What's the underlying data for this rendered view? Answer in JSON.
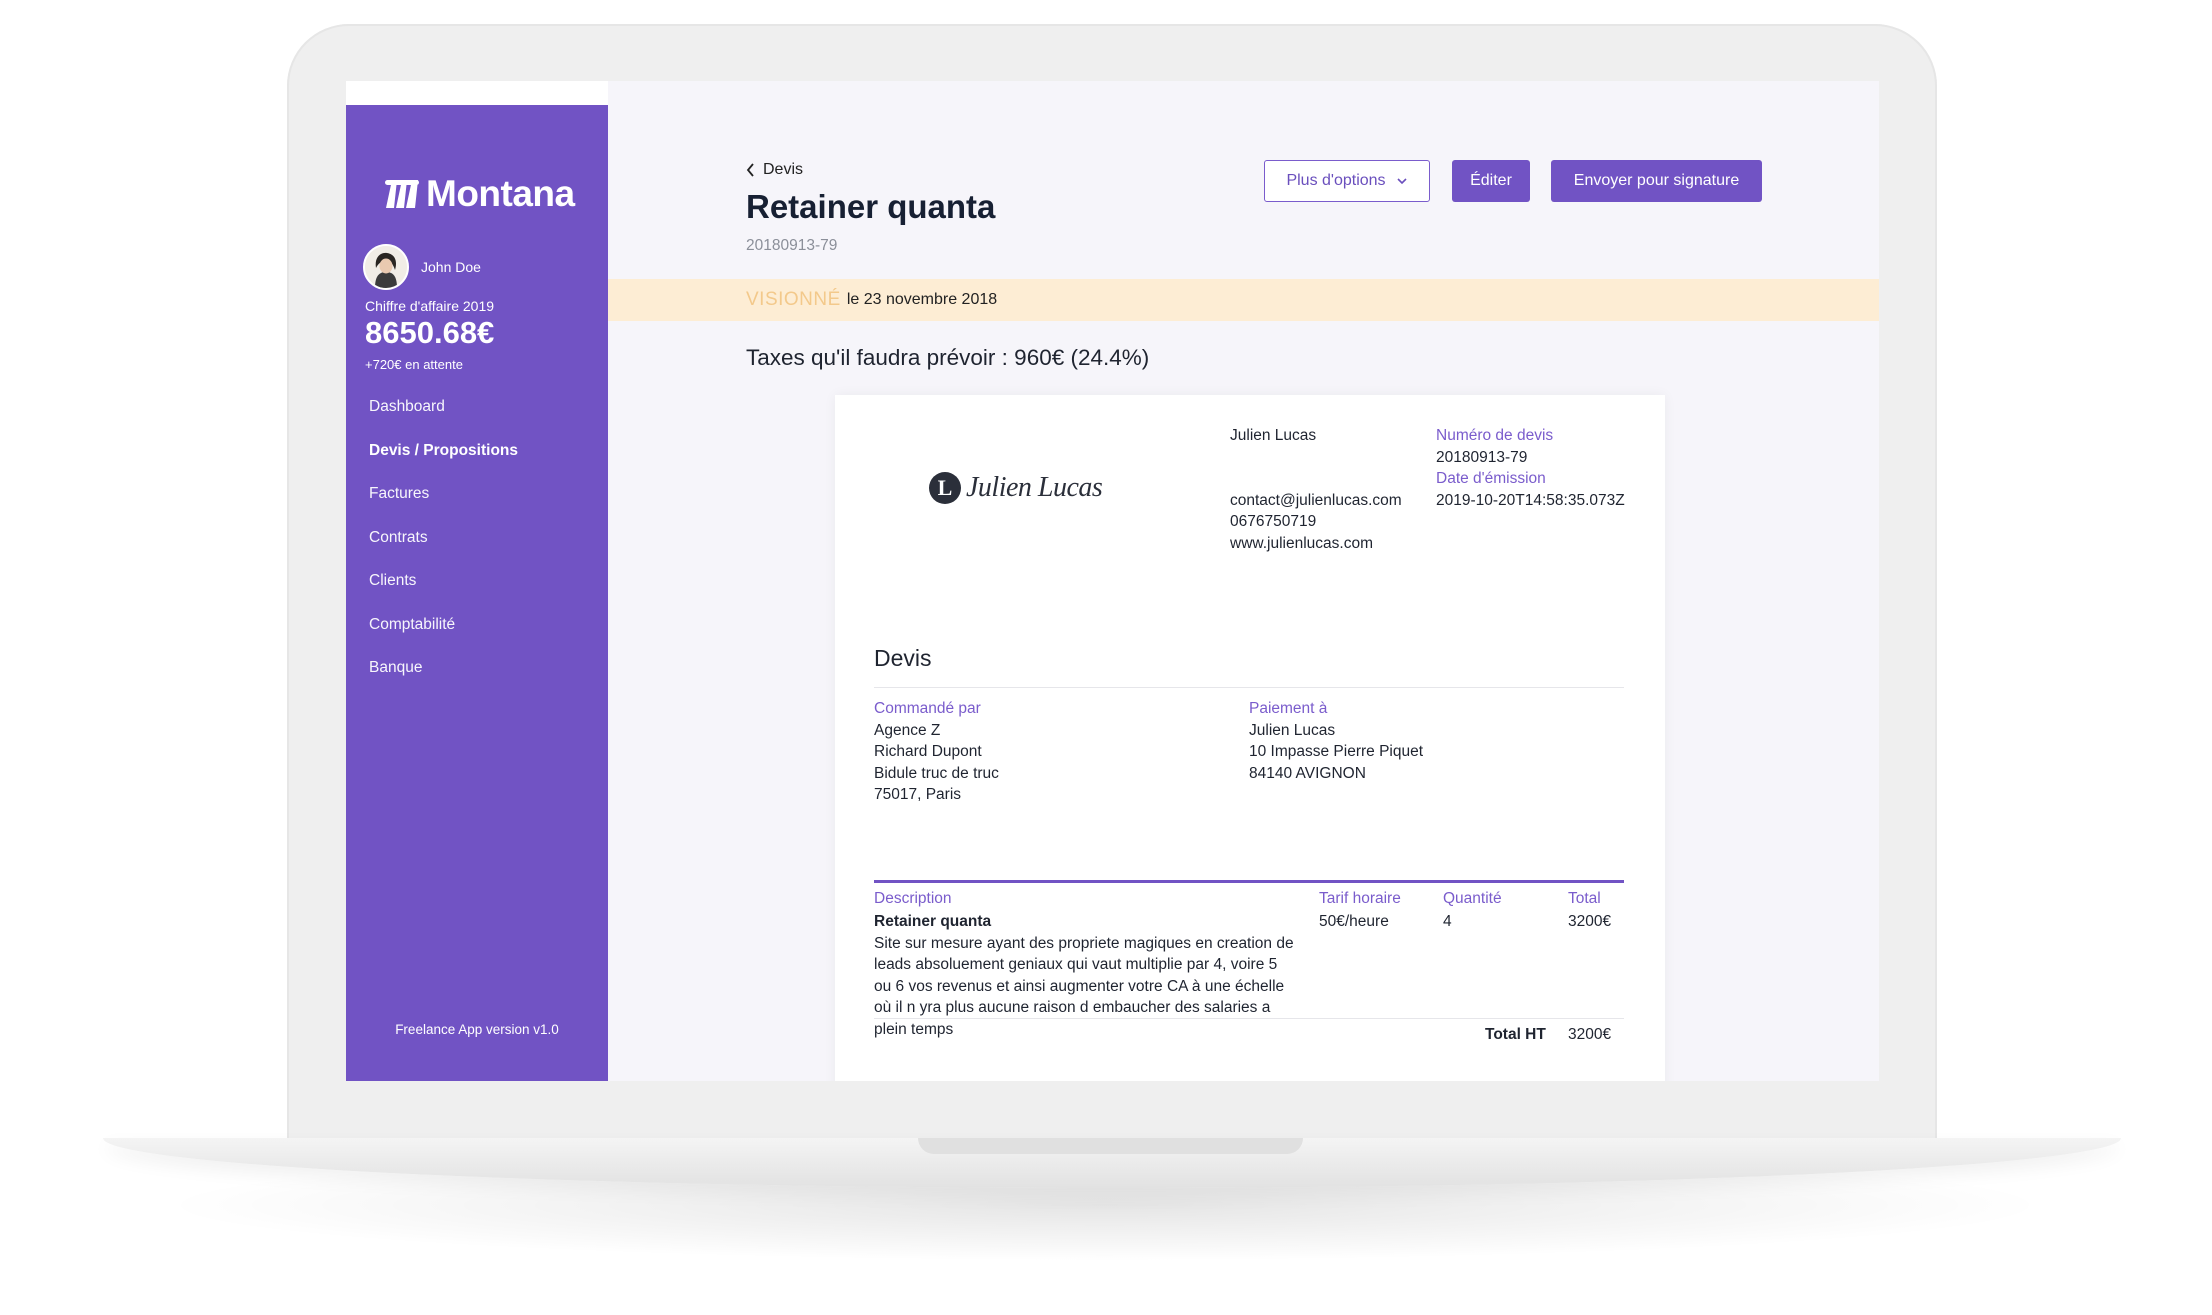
{
  "sidebar": {
    "brand": "Montana",
    "user_name": "John Doe",
    "revenue_label": "Chiffre d'affaire 2019",
    "revenue_value": "8650.68€",
    "revenue_pending": "+720€ en attente",
    "nav": [
      {
        "label": "Dashboard",
        "active": false
      },
      {
        "label": "Devis / Propositions",
        "active": true
      },
      {
        "label": "Factures",
        "active": false
      },
      {
        "label": "Contrats",
        "active": false
      },
      {
        "label": "Clients",
        "active": false
      },
      {
        "label": "Comptabilité",
        "active": false
      },
      {
        "label": "Banque",
        "active": false
      }
    ],
    "version": "Freelance App version v1.0"
  },
  "header": {
    "back_label": "Devis",
    "title": "Retainer quanta",
    "reference": "20180913-79",
    "buttons": {
      "options": "Plus d'options",
      "edit": "Éditer",
      "sign": "Envoyer pour signature"
    }
  },
  "banner": {
    "status": "VISIONNÉ",
    "date": "le 23 novembre 2018"
  },
  "taxes": "Taxes qu'il faudra prévoir : 960€ (24.4%)",
  "document": {
    "logo_letter": "L",
    "logo_text": "Julien Lucas",
    "issuer": {
      "name": "Julien Lucas",
      "email": "contact@julienlucas.com",
      "phone": "0676750719",
      "website": "www.julienlucas.com"
    },
    "meta": {
      "number_label": "Numéro de devis",
      "number_value": "20180913-79",
      "date_label": "Date d'émission",
      "date_value": "2019-10-20T14:58:35.073Z"
    },
    "section_title": "Devis",
    "ordered_by": {
      "label": "Commandé par",
      "lines": [
        "Agence Z",
        "Richard Dupont",
        "Bidule truc de truc",
        "75017, Paris"
      ]
    },
    "payment_to": {
      "label": "Paiement à",
      "lines": [
        "Julien Lucas",
        "10 Impasse Pierre Piquet",
        "84140 AVIGNON"
      ]
    },
    "table": {
      "headers": {
        "description": "Description",
        "rate": "Tarif horaire",
        "quantity": "Quantité",
        "total": "Total"
      },
      "item": {
        "name": "Retainer quanta",
        "description": "Site sur mesure ayant des propriete magiques en creation de leads absoluement geniaux qui vaut multiplie par 4, voire 5 ou 6 vos revenus et ainsi augmenter votre CA à une échelle où il n yra plus aucune raison d embaucher des salaries a plein temps",
        "rate": "50€/heure",
        "quantity": "4",
        "total": "3200€"
      },
      "total_ht_label": "Total HT",
      "total_ht_value": "3200€"
    }
  },
  "colors": {
    "accent": "#7153c4",
    "banner_bg": "#fdedd4",
    "banner_status": "#f3c98b",
    "label": "#7a5ccc"
  }
}
